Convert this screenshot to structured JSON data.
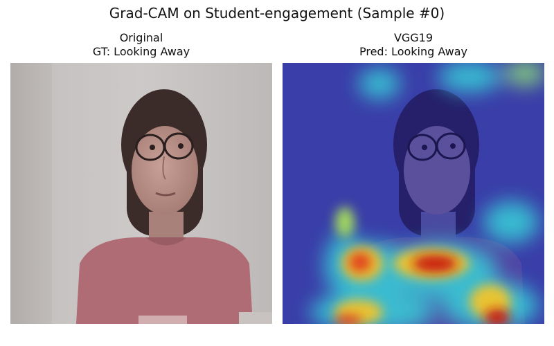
{
  "figure": {
    "title": "Grad-CAM on Student-engagement (Sample #0)"
  },
  "panels": [
    {
      "title_line1": "Original",
      "title_line2": "GT: Looking Away"
    },
    {
      "title_line1": "VGG19",
      "title_line2": "Pred: Looking Away"
    }
  ],
  "colors": {
    "background": "#ffffff",
    "photo_wall": "#c9c5c4",
    "shirt": "#b06c74",
    "hair": "#3a2a28",
    "skin": "#b98f86",
    "heatmap_low": "#2b2fb8",
    "heatmap_mid": "#39d0d8",
    "heatmap_warm": "#f2c52a",
    "heatmap_hot": "#c8140e"
  }
}
